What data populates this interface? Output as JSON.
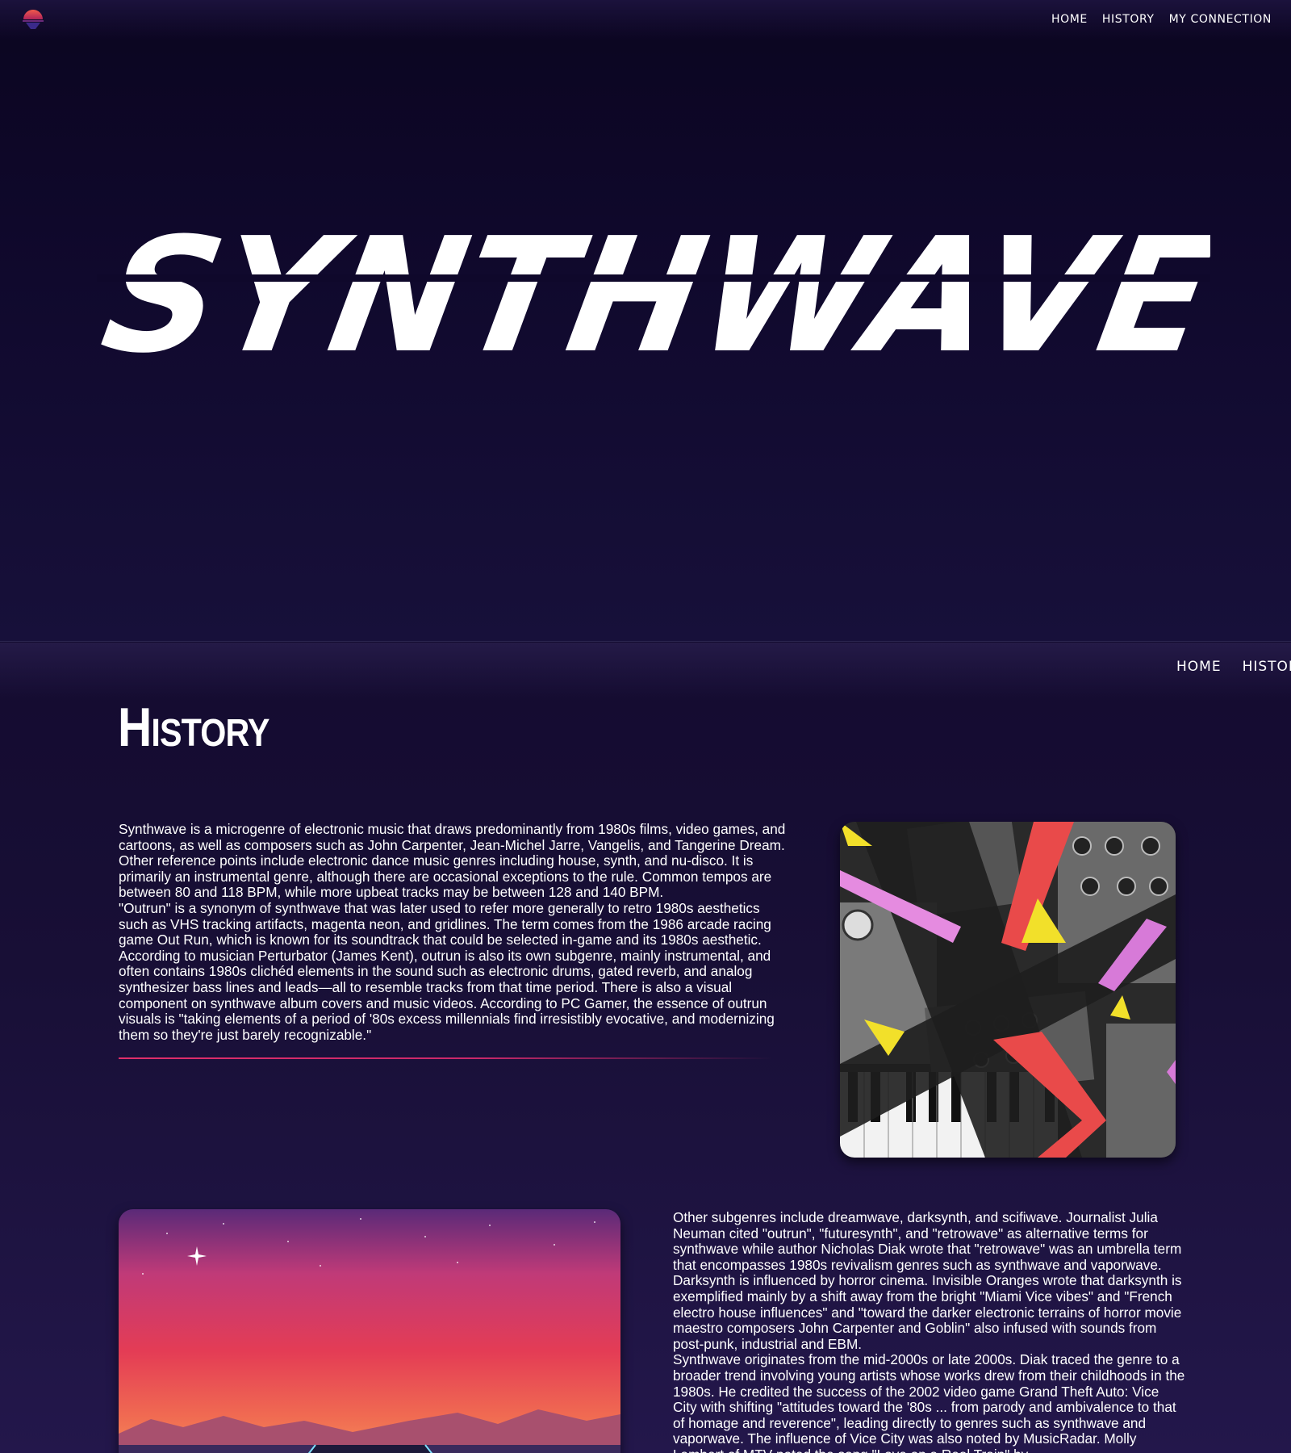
{
  "hero": {
    "title": "SYNTHWAVE",
    "logo_icon": "sunset-logo-icon",
    "nav": [
      "HOME",
      "HISTORY",
      "MY CONNECTION"
    ]
  },
  "history_section": {
    "nav": [
      "HOME",
      "HISTORY"
    ],
    "title": "History",
    "block1": {
      "paragraphs": [
        "Synthwave is a microgenre of electronic music that draws predominantly from 1980s films, video games, and cartoons, as well as composers such as John Carpenter, Jean-Michel Jarre, Vangelis, and Tangerine Dream. Other reference points include electronic dance music genres including house, synth, and nu-disco. It is primarily an instrumental genre, although there are occasional exceptions to the rule. Common tempos are between 80 and 118 BPM, while more upbeat tracks may be between 128 and 140 BPM.",
        "\"Outrun\" is a synonym of synthwave that was later used to refer more generally to retro 1980s aesthetics such as VHS tracking artifacts, magenta neon, and gridlines. The term comes from the 1986 arcade racing game Out Run, which is known for its soundtrack that could be selected in-game and its 1980s aesthetic. According to musician Perturbator (James Kent), outrun is also its own subgenre, mainly instrumental, and often contains 1980s clichéd elements in the sound such as electronic drums, gated reverb, and analog synthesizer bass lines and leads—all to resemble tracks from that time period. There is also a visual component on synthwave album covers and music videos. According to PC Gamer, the essence of outrun visuals is \"taking elements of a period of '80s excess millennials find irresistibly evocative, and modernizing them so they're just barely recognizable.\""
      ],
      "image_icon": "synthesizer-collage-image"
    },
    "block2": {
      "paragraphs": [
        "Other subgenres include dreamwave, darksynth, and scifiwave. Journalist Julia Neuman cited \"outrun\", \"futuresynth\", and \"retrowave\" as alternative terms for synthwave while author Nicholas Diak wrote that \"retrowave\" was an umbrella term that encompasses 1980s revivalism genres such as synthwave and vaporwave. Darksynth is influenced by horror cinema. Invisible Oranges wrote that darksynth is exemplified mainly by a shift away from the bright \"Miami Vice vibes\" and \"French electro house influences\" and \"toward the darker electronic terrains of horror movie maestro composers John Carpenter and Goblin\" also infused with sounds from post-punk, industrial and EBM.",
        "Synthwave originates from the mid-2000s or late 2000s. Diak traced the genre to a broader trend involving young artists whose works drew from their childhoods in the 1980s. He credited the success of the 2002 video game Grand Theft Auto: Vice City with shifting \"attitudes toward the '80s ... from parody and ambivalence to that of homage and reverence\", leading directly to genres such as synthwave and vaporwave. The influence of Vice City was also noted by MusicRadar. Molly Lambert of MTV noted the song \"Love on a Real Train\" by"
      ],
      "image_icon": "synthwave-sunset-image"
    }
  },
  "colors": {
    "background": "#120a2e",
    "accent_divider": "#e02e6a",
    "text": "#ffffff"
  }
}
